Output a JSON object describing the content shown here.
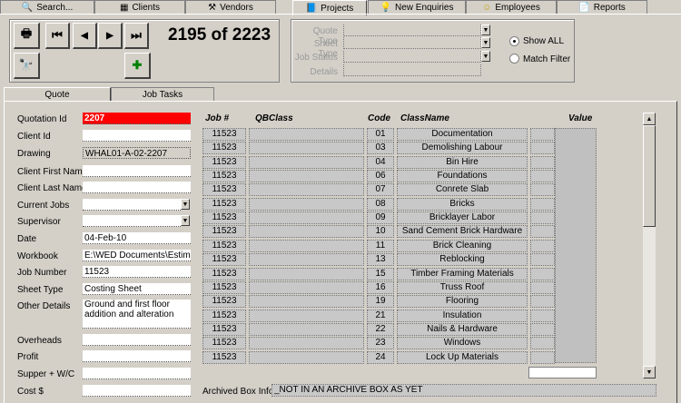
{
  "tabs": [
    {
      "label": "Search...",
      "icon": "search-icon"
    },
    {
      "label": "Clients",
      "icon": "grid-icon"
    },
    {
      "label": "Vendors",
      "icon": "hammer-icon"
    },
    {
      "label": "Projects",
      "icon": "book-icon"
    },
    {
      "label": "New Enquiries",
      "icon": "bulb-icon"
    },
    {
      "label": "Employees",
      "icon": "smiley-icon"
    },
    {
      "label": "Reports",
      "icon": "report-icon"
    }
  ],
  "record": {
    "counter": "2195 of 2223"
  },
  "filter": {
    "quote_type": "Quote Type",
    "sheet_type": "Sheet Type",
    "job_status": "Job Status",
    "details": "Details",
    "show_all": "Show ALL",
    "match_filter": "Match Filter"
  },
  "subtabs": {
    "quote": "Quote",
    "job_tasks": "Job Tasks"
  },
  "fields": {
    "quotation_id": {
      "label": "Quotation Id",
      "value": "2207"
    },
    "client_id": {
      "label": "Client Id",
      "value": ""
    },
    "drawing": {
      "label": "Drawing",
      "value": "WHAL01-A-02-2207"
    },
    "first_name": {
      "label": "Client First Name",
      "value": ""
    },
    "last_name": {
      "label": "Client Last Name",
      "value": ""
    },
    "current_jobs": {
      "label": "Current Jobs",
      "value": ""
    },
    "supervisor": {
      "label": "Supervisor",
      "value": ""
    },
    "date": {
      "label": "Date",
      "value": "04-Feb-10"
    },
    "workbook": {
      "label": "Workbook",
      "value": "E:\\WED Documents\\Estimating\\"
    },
    "job_number": {
      "label": "Job Number",
      "value": "11523"
    },
    "sheet_type": {
      "label": "Sheet Type",
      "value": "Costing Sheet"
    },
    "other_details": {
      "label": "Other Details",
      "value": "Ground and first floor addition and alteration"
    },
    "overheads": {
      "label": "Overheads",
      "value": ""
    },
    "profit": {
      "label": "Profit",
      "value": ""
    },
    "supper": {
      "label": "Supper + W/C",
      "value": ""
    },
    "cost": {
      "label": "Cost  $",
      "value": ""
    }
  },
  "table": {
    "headers": {
      "job": "Job #",
      "qbclass": "QBClass",
      "code": "Code",
      "classname": "ClassName",
      "value": "Value"
    },
    "rows": [
      {
        "job": "11523",
        "code": "01",
        "classname": "Documentation"
      },
      {
        "job": "11523",
        "code": "03",
        "classname": "Demolishing Labour"
      },
      {
        "job": "11523",
        "code": "04",
        "classname": "Bin Hire"
      },
      {
        "job": "11523",
        "code": "06",
        "classname": "Foundations"
      },
      {
        "job": "11523",
        "code": "07",
        "classname": "Conrete Slab"
      },
      {
        "job": "11523",
        "code": "08",
        "classname": "Bricks"
      },
      {
        "job": "11523",
        "code": "09",
        "classname": "Bricklayer Labor"
      },
      {
        "job": "11523",
        "code": "10",
        "classname": "Sand Cement Brick Hardware"
      },
      {
        "job": "11523",
        "code": "11",
        "classname": "Brick Cleaning"
      },
      {
        "job": "11523",
        "code": "13",
        "classname": "Reblocking"
      },
      {
        "job": "11523",
        "code": "15",
        "classname": "Timber Framing Materials"
      },
      {
        "job": "11523",
        "code": "16",
        "classname": "Truss Roof"
      },
      {
        "job": "11523",
        "code": "19",
        "classname": "Flooring"
      },
      {
        "job": "11523",
        "code": "21",
        "classname": "Insulation"
      },
      {
        "job": "11523",
        "code": "22",
        "classname": "Nails & Hardware"
      },
      {
        "job": "11523",
        "code": "23",
        "classname": "Windows"
      },
      {
        "job": "11523",
        "code": "24",
        "classname": "Lock Up Materials"
      }
    ]
  },
  "archive": {
    "label": "Archived Box Info :",
    "value": "_NOT IN AN ARCHIVE BOX AS YET"
  }
}
